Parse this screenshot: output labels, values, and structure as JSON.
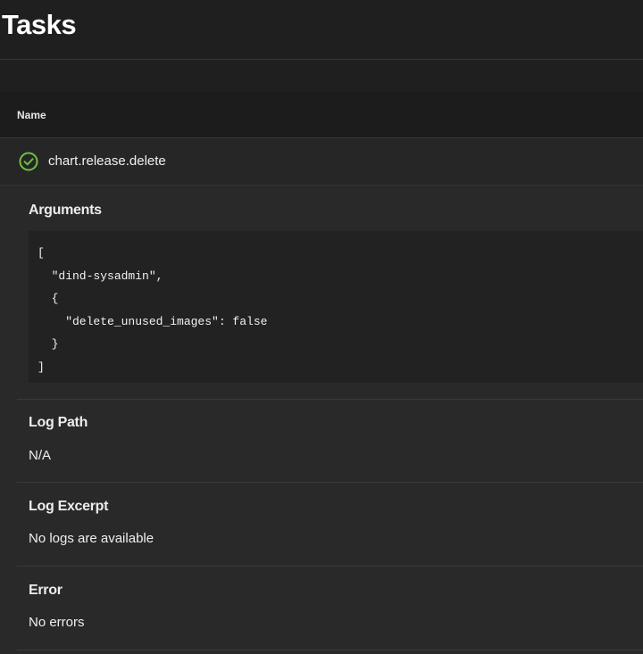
{
  "header": {
    "title": "Tasks"
  },
  "table": {
    "columns": [
      "Name"
    ]
  },
  "task": {
    "name": "chart.release.delete",
    "status_icon": "check-circle-icon",
    "status_color": "#71bf44"
  },
  "details": {
    "arguments": {
      "title": "Arguments",
      "code": "[\n  \"dind-sysadmin\",\n  {\n    \"delete_unused_images\": false\n  }\n]"
    },
    "log_path": {
      "title": "Log Path",
      "value": "N/A"
    },
    "log_excerpt": {
      "title": "Log Excerpt",
      "value": "No logs are available"
    },
    "error": {
      "title": "Error",
      "value": "No errors"
    }
  }
}
